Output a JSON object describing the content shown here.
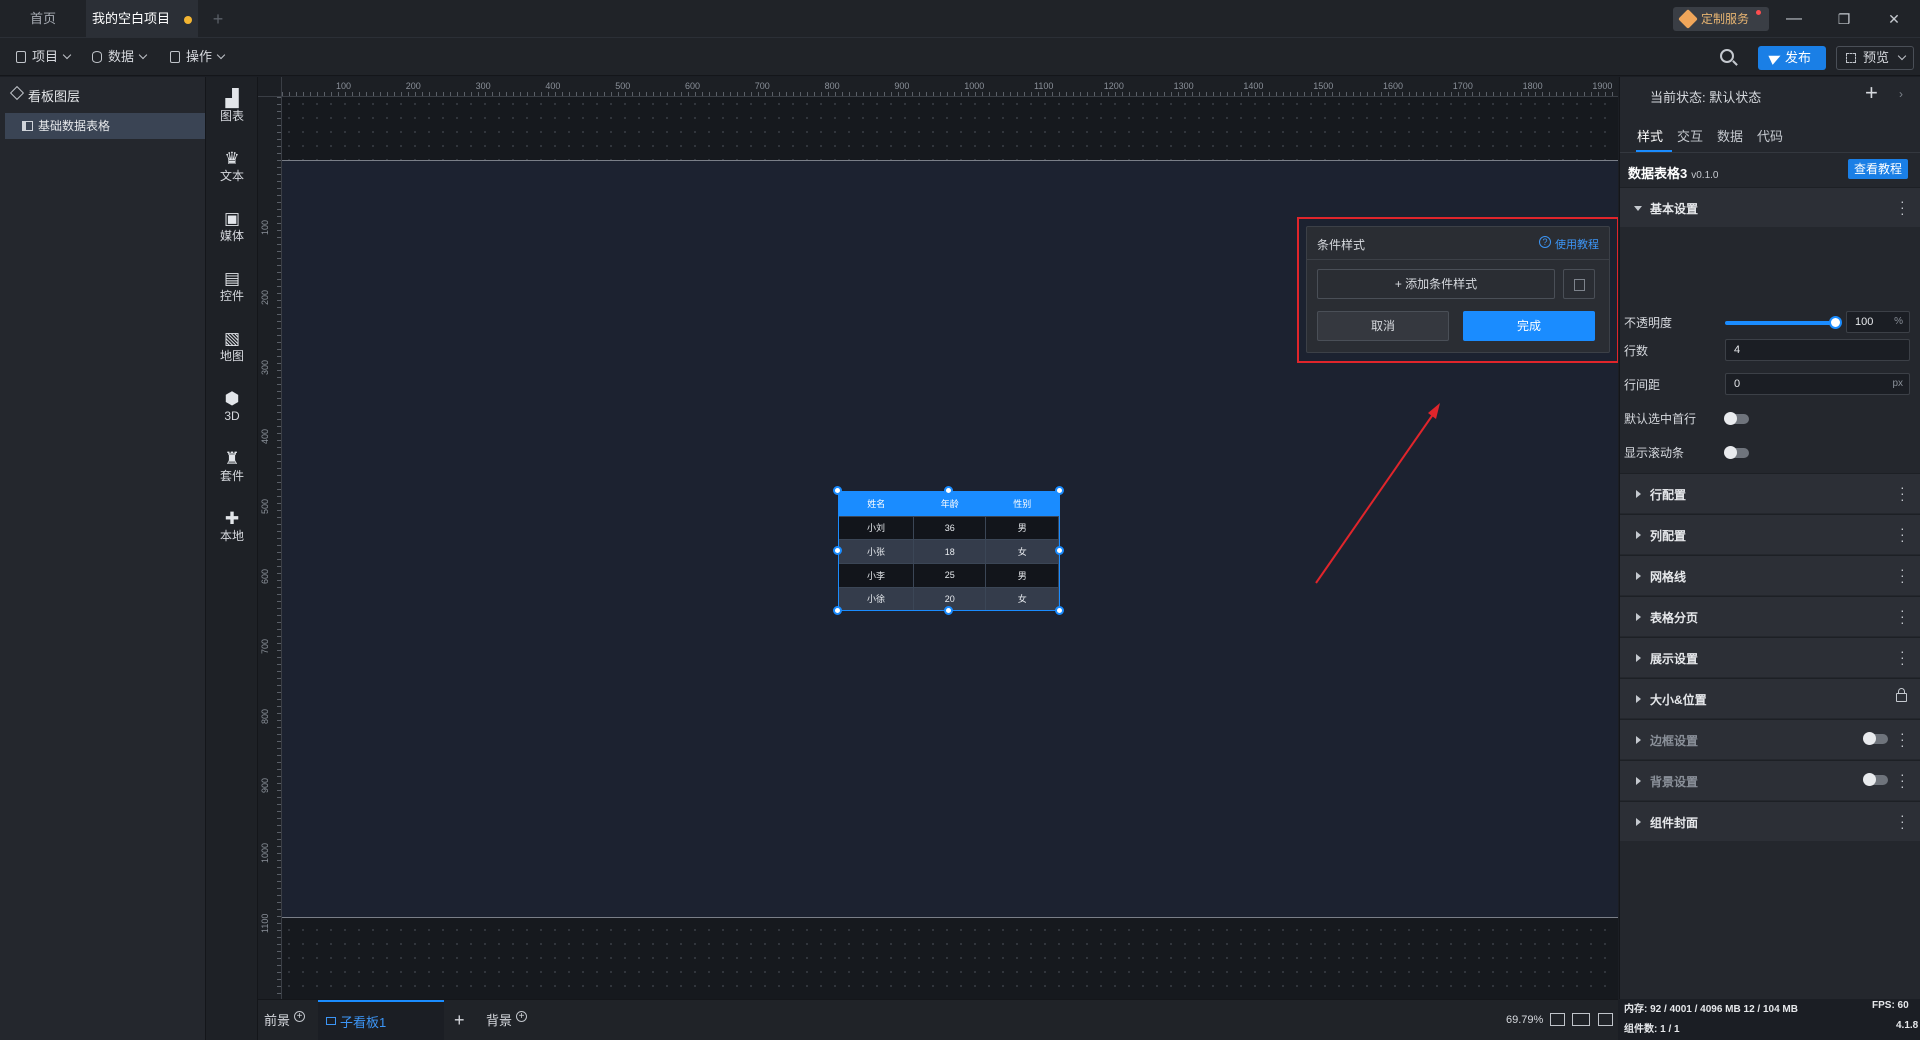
{
  "titlebar": {
    "tabs": [
      "首页",
      "我的空白项目"
    ],
    "new_tab": "+",
    "custom_service": "定制服务",
    "minimize": "—",
    "restore": "❐",
    "close": "✕"
  },
  "toolbar": {
    "project": "项目",
    "data": "数据",
    "operation": "操作",
    "publish": "发布",
    "preview": "预览"
  },
  "layers": {
    "title": "看板图层",
    "items": [
      "基础数据表格"
    ]
  },
  "components": [
    {
      "label": "图表",
      "icon": "bar-chart-icon",
      "glyph": "▟"
    },
    {
      "label": "文本",
      "icon": "crown-icon",
      "glyph": "♛"
    },
    {
      "label": "媒体",
      "icon": "media-icon",
      "glyph": "▣"
    },
    {
      "label": "控件",
      "icon": "widget-icon",
      "glyph": "▤"
    },
    {
      "label": "地图",
      "icon": "map-icon",
      "glyph": "▧"
    },
    {
      "label": "3D",
      "icon": "cube-icon",
      "glyph": "⬢"
    },
    {
      "label": "套件",
      "icon": "shirt-icon",
      "glyph": "♜"
    },
    {
      "label": "本地",
      "icon": "puzzle-icon",
      "glyph": "✚"
    }
  ],
  "ruler": {
    "top": [
      "100",
      "200",
      "300",
      "400",
      "500",
      "600",
      "700",
      "800",
      "900",
      "1000",
      "1100",
      "1200",
      "1300",
      "1400",
      "1500",
      "1600",
      "1700",
      "1800",
      "1900"
    ],
    "left": [
      "100",
      "200",
      "300",
      "400",
      "500",
      "600",
      "700",
      "800",
      "900",
      "1000",
      "1100"
    ]
  },
  "table_widget": {
    "headers": [
      "姓名",
      "年龄",
      "性别"
    ],
    "rows": [
      [
        "小刘",
        "36",
        "男"
      ],
      [
        "小张",
        "18",
        "女"
      ],
      [
        "小李",
        "25",
        "男"
      ],
      [
        "小徐",
        "20",
        "女"
      ]
    ]
  },
  "condition_popup": {
    "title": "条件样式",
    "help": "使用教程",
    "add": "+ 添加条件样式",
    "cancel": "取消",
    "done": "完成"
  },
  "bottom": {
    "foreground": "前景",
    "subboard": "子看板1",
    "add": "+",
    "background": "背景",
    "zoom": "69.79%"
  },
  "right_panel": {
    "state": "当前状态:  默认状态",
    "add_state": "+",
    "tabs": [
      "样式",
      "交互",
      "数据",
      "代码"
    ],
    "component_name": "数据表格3",
    "component_version": "v0.1.0",
    "tutorial": "查看教程",
    "basic_section": "基本设置",
    "props": {
      "opacity_label": "不透明度",
      "opacity_value": "100",
      "opacity_unit": "%",
      "opacity_fraction": 1.0,
      "rows_label": "行数",
      "rows_value": "4",
      "row_gap_label": "行间距",
      "row_gap_value": "0",
      "row_gap_unit": "px",
      "select_first_label": "默认选中首行",
      "scrollbar_label": "显示滚动条"
    },
    "sections": [
      "行配置",
      "列配置",
      "网格线",
      "表格分页",
      "展示设置",
      "大小&位置",
      "边框设置",
      "背景设置",
      "组件封面"
    ]
  },
  "status": {
    "memory": "内存:  92 / 4001 / 4096 MB  12 / 104 MB",
    "fps": "FPS:  60",
    "count": "组件数: 1 / 1",
    "version": "4.1.8"
  }
}
